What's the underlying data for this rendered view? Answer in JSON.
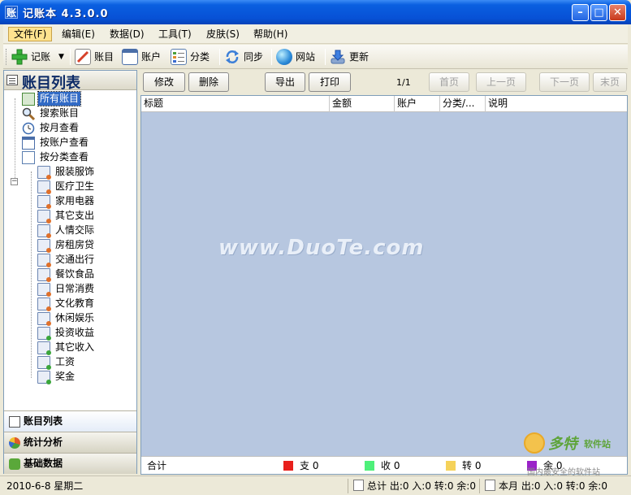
{
  "window": {
    "title": "记账本  4.3.0.0",
    "app_icon_glyph": "账"
  },
  "menu": [
    "文件(F)",
    "编辑(E)",
    "数据(D)",
    "工具(T)",
    "皮肤(S)",
    "帮助(H)"
  ],
  "toolbar": {
    "record": "记账",
    "accounts_book": "账目",
    "account": "账户",
    "category": "分类",
    "sync": "同步",
    "website": "网站",
    "update": "更新"
  },
  "left_panel": {
    "title": "账目列表",
    "tree": {
      "all": "所有账目",
      "search": "搜索账目",
      "by_month": "按月查看",
      "by_account": "按账户查看",
      "by_category": "按分类查看",
      "categories": [
        "服装服饰",
        "医疗卫生",
        "家用电器",
        "其它支出",
        "人情交际",
        "房租房贷",
        "交通出行",
        "餐饮食品",
        "日常消费",
        "文化教育",
        "休闲娱乐",
        "投资收益",
        "其它收入",
        "工资",
        "奖金"
      ]
    },
    "nav": [
      "账目列表",
      "统计分析",
      "基础数据"
    ]
  },
  "actions": {
    "edit": "修改",
    "delete": "删除",
    "export": "导出",
    "print": "打印",
    "page_info": "1/1",
    "first": "首页",
    "prev": "上一页",
    "next": "下一页",
    "last": "末页"
  },
  "grid": {
    "columns": [
      "标题",
      "金额",
      "账户",
      "分类/...",
      "说明"
    ],
    "watermark": "www.DuoTe.com"
  },
  "footer": {
    "total_label": "合计",
    "expense": "支 0",
    "income": "收 0",
    "transfer": "转 0",
    "balance": "余 0"
  },
  "colors": {
    "expense": "#e8201c",
    "income": "#4ef07a",
    "transfer": "#f5d25a",
    "balance": "#9a22c8"
  },
  "status": {
    "date": "2010-6-8 星期二",
    "total": "总计 出:0 入:0 转:0 余:0",
    "month": "本月 出:0 入:0 转:0 余:0"
  },
  "branding": {
    "name": "多特",
    "sub": "软件站",
    "tagline": "国内最安全的软件站"
  }
}
